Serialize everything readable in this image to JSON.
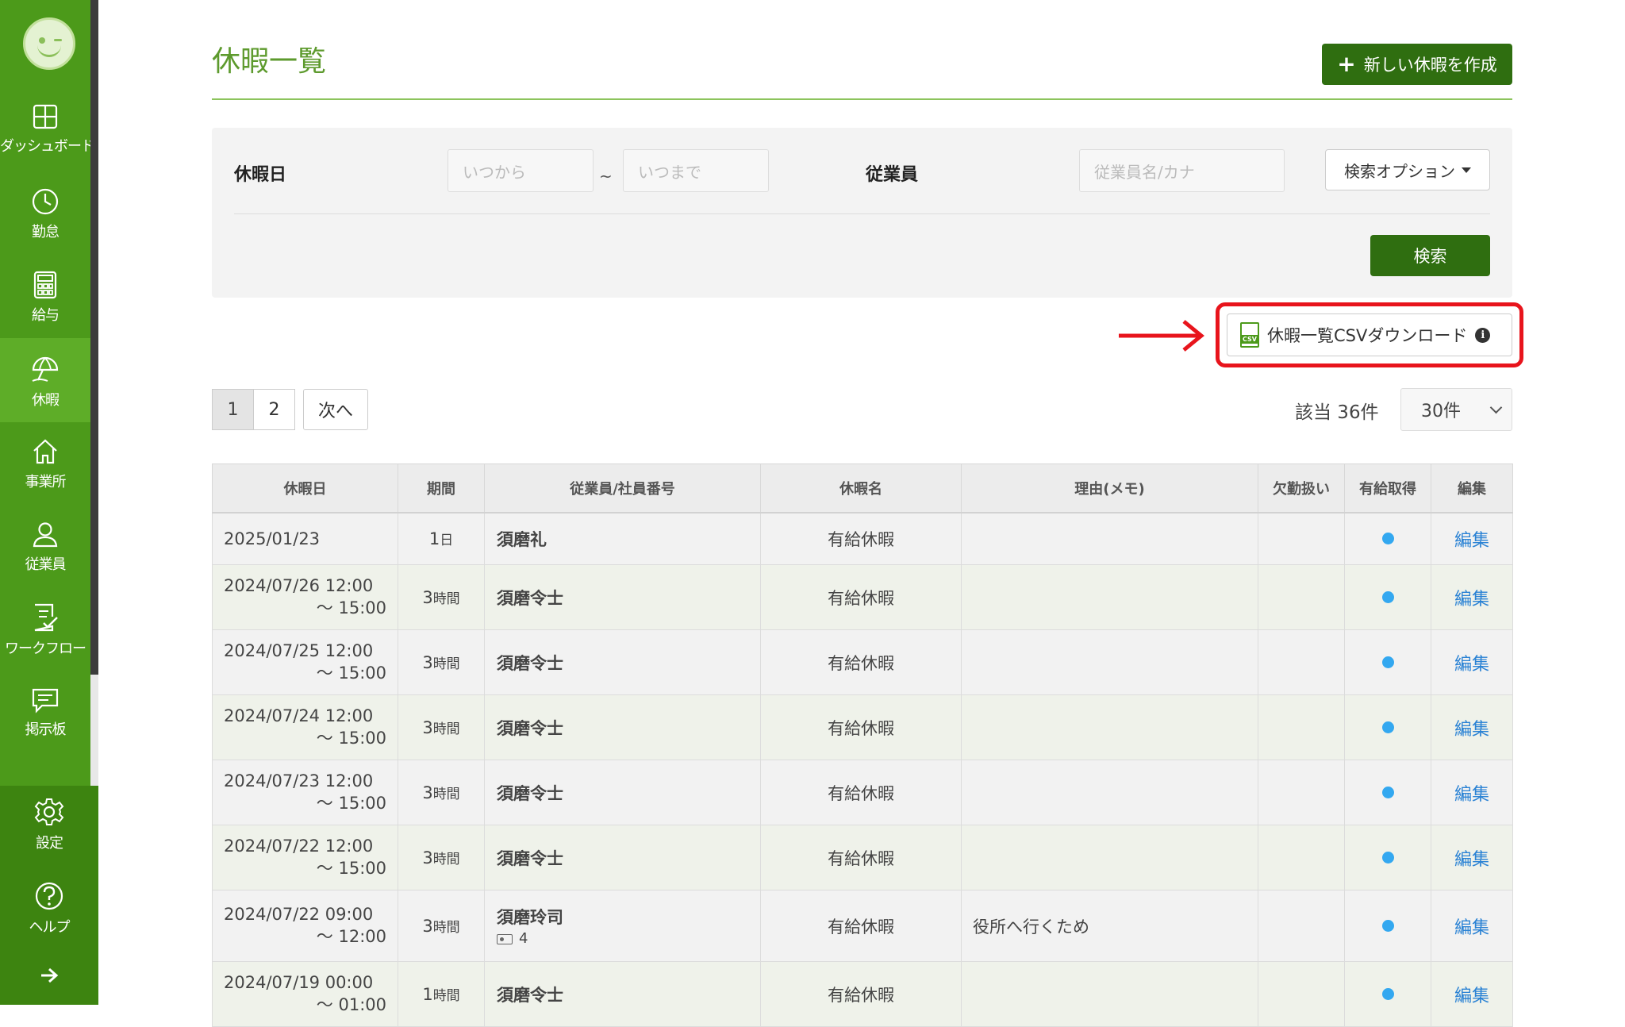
{
  "sidebar": {
    "items": [
      {
        "label": "ダッシュボード",
        "icon": "dashboard-icon"
      },
      {
        "label": "勤怠",
        "icon": "clock-icon"
      },
      {
        "label": "給与",
        "icon": "calculator-icon"
      },
      {
        "label": "休暇",
        "icon": "umbrella-icon",
        "active": true
      },
      {
        "label": "事業所",
        "icon": "home-icon"
      },
      {
        "label": "従業員",
        "icon": "person-icon"
      },
      {
        "label": "ワークフロー",
        "icon": "checklist-icon"
      },
      {
        "label": "掲示板",
        "icon": "message-icon"
      }
    ],
    "bottom_items": [
      {
        "label": "設定",
        "icon": "gear-icon"
      },
      {
        "label": "ヘルプ",
        "icon": "help-icon"
      }
    ],
    "expand_icon": "arrow-right-icon"
  },
  "header": {
    "title": "休暇一覧",
    "create_button": "新しい休暇を作成"
  },
  "search": {
    "leave_date_label": "休暇日",
    "from_placeholder": "いつから",
    "tilde": "~",
    "to_placeholder": "いつまで",
    "employee_label": "従業員",
    "employee_placeholder": "従業員名/カナ",
    "options_button": "検索オプション",
    "search_button": "検索"
  },
  "csv_download": {
    "label": "休暇一覧CSVダウンロード",
    "icon_tag": "CSV",
    "highlight_color": "#e8141c"
  },
  "pagination": {
    "pages": [
      "1",
      "2"
    ],
    "current": "1",
    "next": "次へ"
  },
  "results": {
    "count_text": "該当 36件",
    "per_page": "30件"
  },
  "table": {
    "headers": [
      "休暇日",
      "期間",
      "従業員/社員番号",
      "休暇名",
      "理由(メモ)",
      "欠勤扱い",
      "有給取得",
      "編集"
    ],
    "rows": [
      {
        "date": "2025/01/23",
        "date_end": "",
        "period_num": "1",
        "period_unit": "日",
        "employee": "須磨礼",
        "emp_no": "",
        "leave_name": "有給休暇",
        "memo": "",
        "paid": true,
        "edit": "編集"
      },
      {
        "date": "2024/07/26 12:00",
        "date_end": "～ 15:00",
        "period_num": "3",
        "period_unit": "時間",
        "employee": "須磨令士",
        "emp_no": "",
        "leave_name": "有給休暇",
        "memo": "",
        "paid": true,
        "edit": "編集"
      },
      {
        "date": "2024/07/25 12:00",
        "date_end": "～ 15:00",
        "period_num": "3",
        "period_unit": "時間",
        "employee": "須磨令士",
        "emp_no": "",
        "leave_name": "有給休暇",
        "memo": "",
        "paid": true,
        "edit": "編集"
      },
      {
        "date": "2024/07/24 12:00",
        "date_end": "～ 15:00",
        "period_num": "3",
        "period_unit": "時間",
        "employee": "須磨令士",
        "emp_no": "",
        "leave_name": "有給休暇",
        "memo": "",
        "paid": true,
        "edit": "編集"
      },
      {
        "date": "2024/07/23 12:00",
        "date_end": "～ 15:00",
        "period_num": "3",
        "period_unit": "時間",
        "employee": "須磨令士",
        "emp_no": "",
        "leave_name": "有給休暇",
        "memo": "",
        "paid": true,
        "edit": "編集"
      },
      {
        "date": "2024/07/22 12:00",
        "date_end": "～ 15:00",
        "period_num": "3",
        "period_unit": "時間",
        "employee": "須磨令士",
        "emp_no": "",
        "leave_name": "有給休暇",
        "memo": "",
        "paid": true,
        "edit": "編集"
      },
      {
        "date": "2024/07/22 09:00",
        "date_end": "～ 12:00",
        "period_num": "3",
        "period_unit": "時間",
        "employee": "須磨玲司",
        "emp_no": "4",
        "leave_name": "有給休暇",
        "memo": "役所へ行くため",
        "paid": true,
        "edit": "編集"
      },
      {
        "date": "2024/07/19 00:00",
        "date_end": "～ 01:00",
        "period_num": "1",
        "period_unit": "時間",
        "employee": "須磨令士",
        "emp_no": "",
        "leave_name": "有給休暇",
        "memo": "",
        "paid": true,
        "edit": "編集"
      }
    ]
  },
  "colors": {
    "brand_green": "#4c9a1a",
    "button_green": "#2f6e10",
    "link_blue": "#2a82d4",
    "paid_dot": "#33a8f0"
  }
}
